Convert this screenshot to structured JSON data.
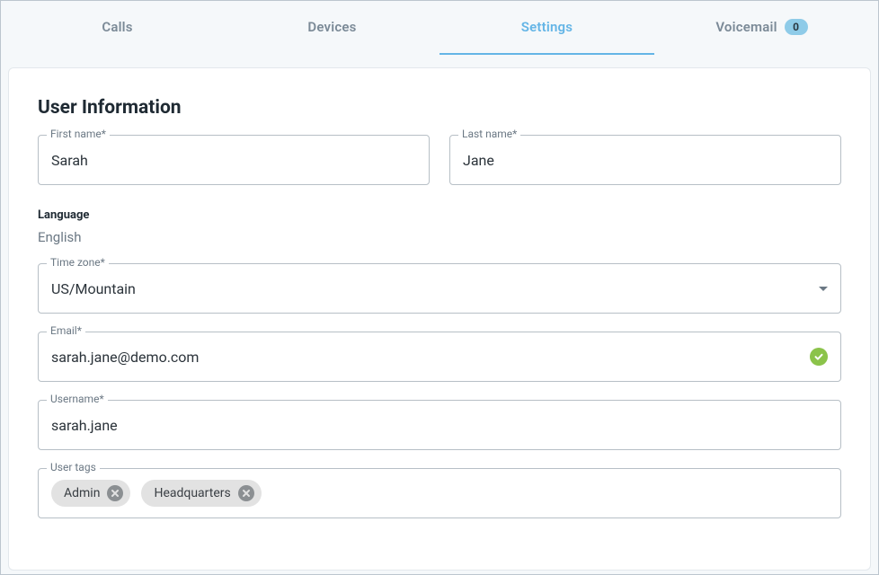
{
  "tabs": {
    "calls": {
      "label": "Calls"
    },
    "devices": {
      "label": "Devices"
    },
    "settings": {
      "label": "Settings"
    },
    "voicemail": {
      "label": "Voicemail",
      "count": "0"
    }
  },
  "section": {
    "title": "User Information",
    "language_label": "Language",
    "language_value": "English"
  },
  "fields": {
    "first_name": {
      "label": "First name*",
      "value": "Sarah"
    },
    "last_name": {
      "label": "Last name*",
      "value": "Jane"
    },
    "time_zone": {
      "label": "Time zone*",
      "value": "US/Mountain"
    },
    "email": {
      "label": "Email*",
      "value": "sarah.jane@demo.com"
    },
    "username": {
      "label": "Username*",
      "value": "sarah.jane"
    },
    "user_tags": {
      "label": "User tags"
    }
  },
  "tags": {
    "0": {
      "label": "Admin"
    },
    "1": {
      "label": "Headquarters"
    }
  }
}
